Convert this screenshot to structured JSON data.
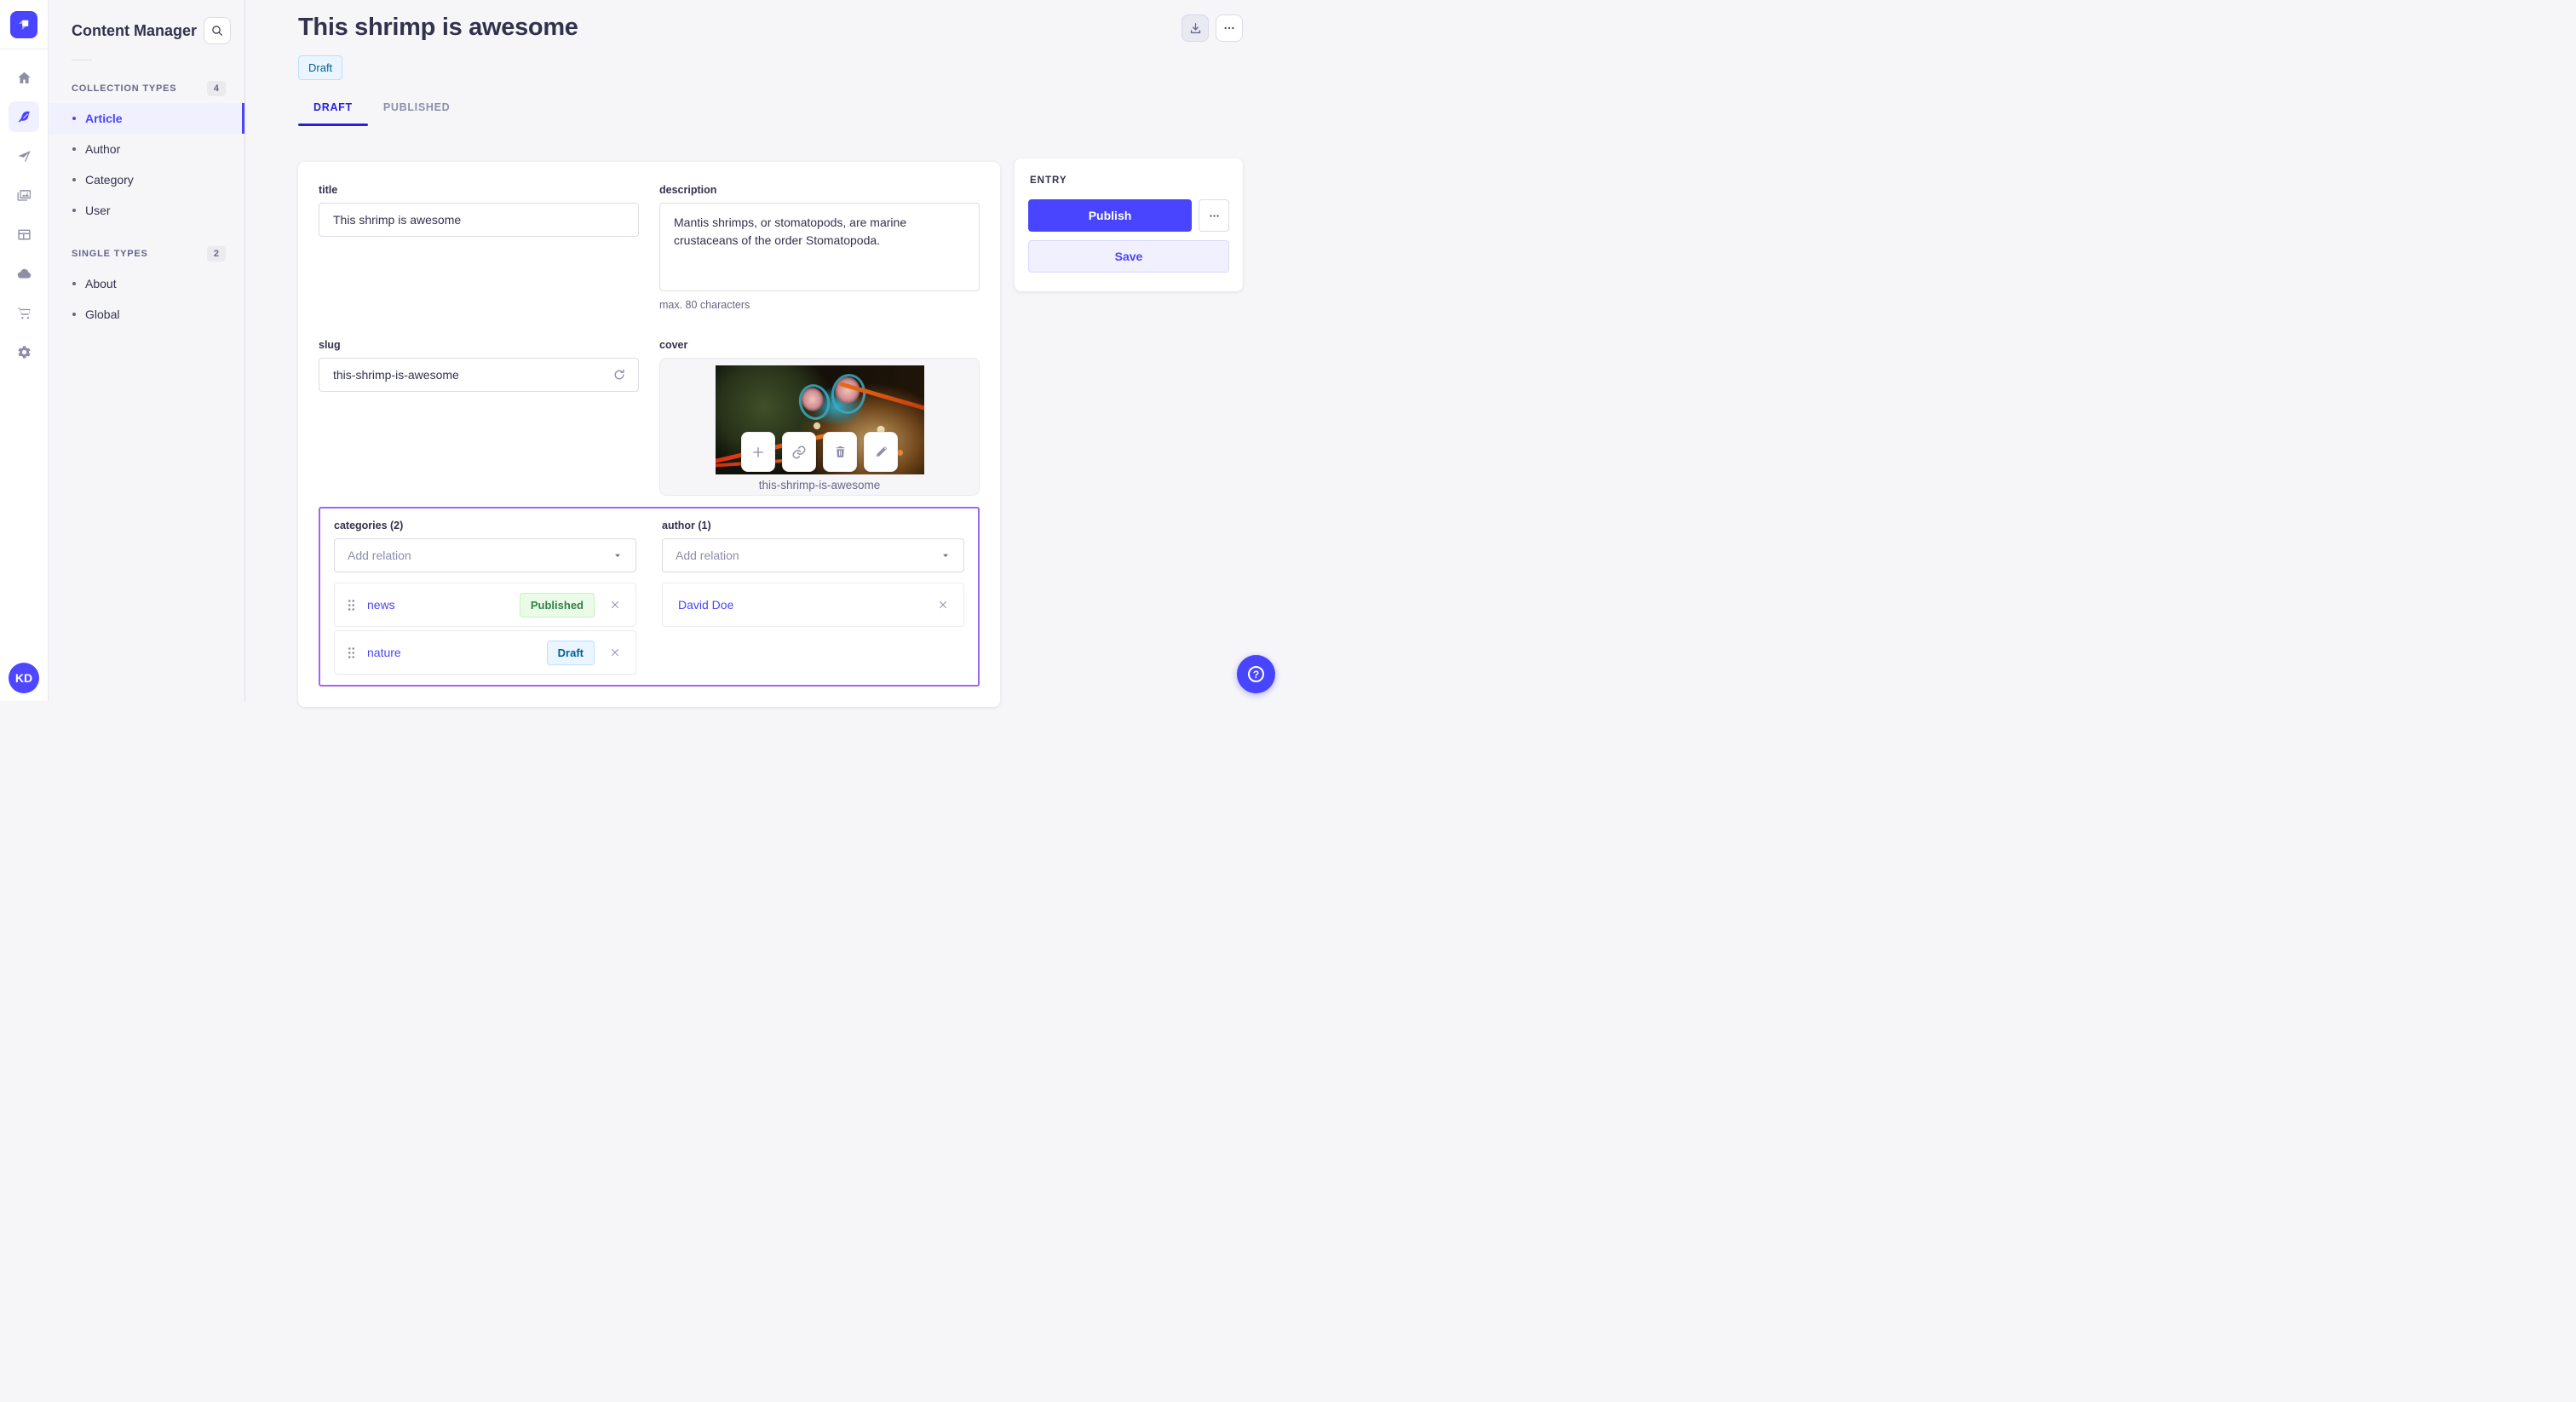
{
  "app": {
    "workspace_initials": "KD",
    "rail_icons": [
      "home-icon",
      "feather-icon",
      "paper-plane-icon",
      "media-images-icon",
      "layout-icon",
      "cloud-icon",
      "cart-icon",
      "gear-icon"
    ]
  },
  "panel": {
    "title": "Content Manager",
    "sections": [
      {
        "label": "COLLECTION TYPES",
        "count": "4",
        "items": [
          {
            "label": "Article"
          },
          {
            "label": "Author"
          },
          {
            "label": "Category"
          },
          {
            "label": "User"
          }
        ]
      },
      {
        "label": "SINGLE TYPES",
        "count": "2",
        "items": [
          {
            "label": "About"
          },
          {
            "label": "Global"
          }
        ]
      }
    ]
  },
  "header": {
    "title": "This shrimp is awesome",
    "status": "Draft"
  },
  "tabs": [
    {
      "label": "DRAFT"
    },
    {
      "label": "PUBLISHED"
    }
  ],
  "form": {
    "title": {
      "label": "title",
      "value": "This shrimp is awesome"
    },
    "description": {
      "label": "description",
      "value": "Mantis shrimps, or stomatopods, are marine crustaceans of the order Stomatopoda.",
      "hint": "max. 80 characters"
    },
    "slug": {
      "label": "slug",
      "value": "this-shrimp-is-awesome"
    },
    "cover": {
      "label": "cover",
      "caption": "this-shrimp-is-awesome"
    },
    "categories": {
      "label": "categories (2)",
      "placeholder": "Add relation",
      "items": [
        {
          "name": "news",
          "status": "Published"
        },
        {
          "name": "nature",
          "status": "Draft"
        }
      ]
    },
    "author": {
      "label": "author (1)",
      "placeholder": "Add relation",
      "items": [
        {
          "name": "David Doe"
        }
      ]
    }
  },
  "entry_panel": {
    "title": "ENTRY",
    "publish_label": "Publish",
    "save_label": "Save"
  },
  "colors": {
    "primary": "#4945ff",
    "tab_active": "#271fe0",
    "relations_highlight": "#9e66f2",
    "draft_text": "#006096",
    "draft_bg": "#eaf5ff",
    "published_text": "#328048",
    "published_bg": "#eafbe7"
  }
}
